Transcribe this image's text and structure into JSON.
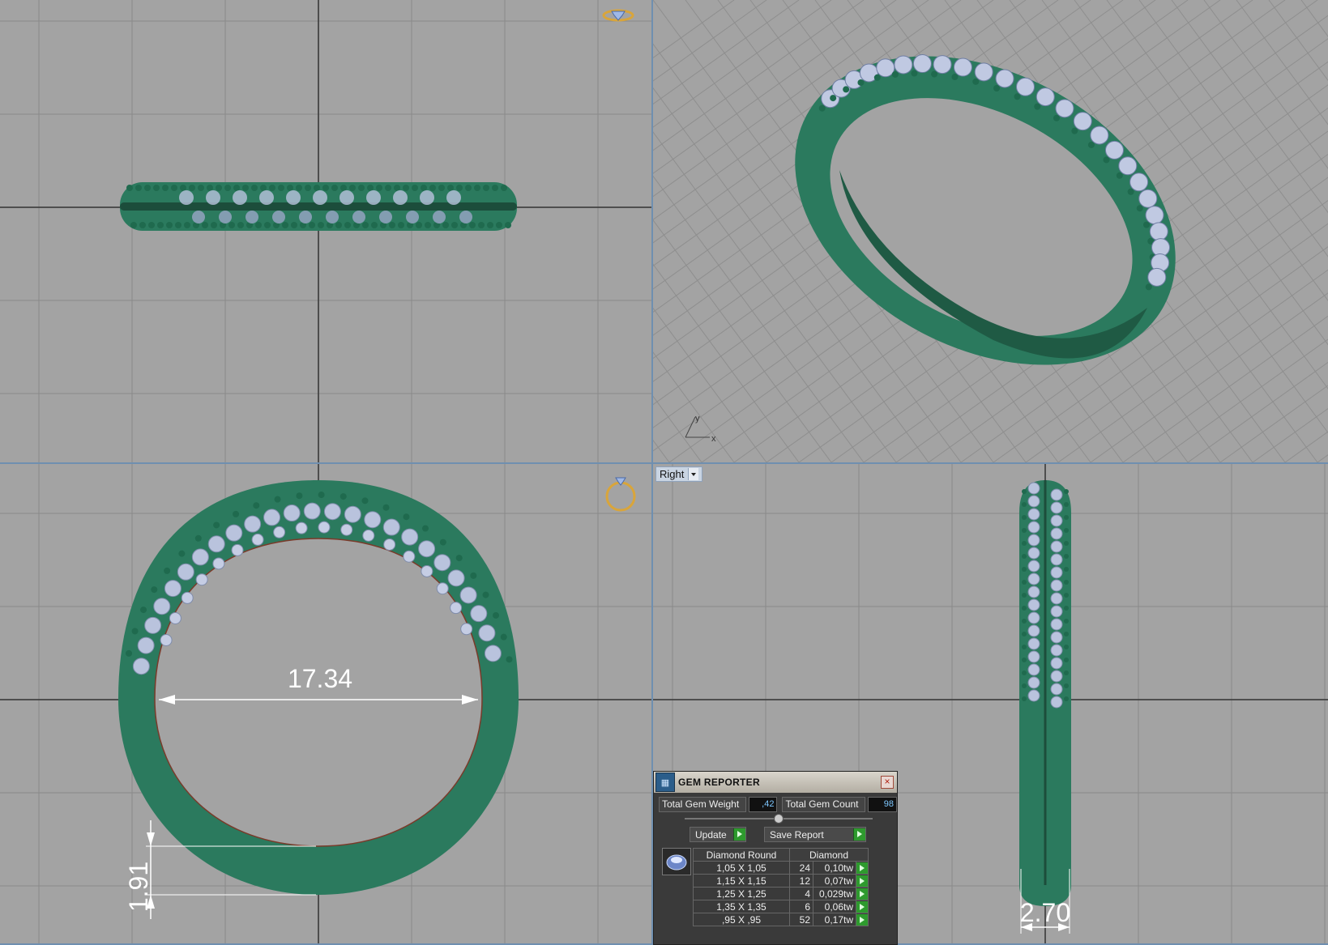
{
  "viewports": {
    "right_label": "Right"
  },
  "dimensions": {
    "inner_diameter": "17.34",
    "band_thickness": "1.91",
    "band_width": "2.70"
  },
  "axis_labels": {
    "x": "x",
    "y": "y"
  },
  "gem_reporter": {
    "title": "GEM REPORTER",
    "total_weight_label": "Total Gem Weight",
    "total_weight_value": ",42",
    "total_count_label": "Total Gem Count",
    "total_count_value": "98",
    "update_label": "Update",
    "save_report_label": "Save Report",
    "table": {
      "header_shape": "Diamond Round",
      "header_material": "Diamond",
      "rows": [
        {
          "size": "1,05 X 1,05",
          "count": "24",
          "weight": "0,10tw"
        },
        {
          "size": "1,15 X 1,15",
          "count": "12",
          "weight": "0,07tw"
        },
        {
          "size": "1,25 X 1,25",
          "count": "4",
          "weight": "0,029tw"
        },
        {
          "size": "1,35 X 1,35",
          "count": "6",
          "weight": "0,06tw"
        },
        {
          "size": ",95 X ,95",
          "count": "52",
          "weight": "0,17tw"
        }
      ]
    }
  },
  "colors": {
    "viewport_bg": "#a3a3a3",
    "grid": "#8a8a8a",
    "axis": "#3a3a3a",
    "metal": "#2f8466",
    "gem": "#b9c3dd"
  }
}
